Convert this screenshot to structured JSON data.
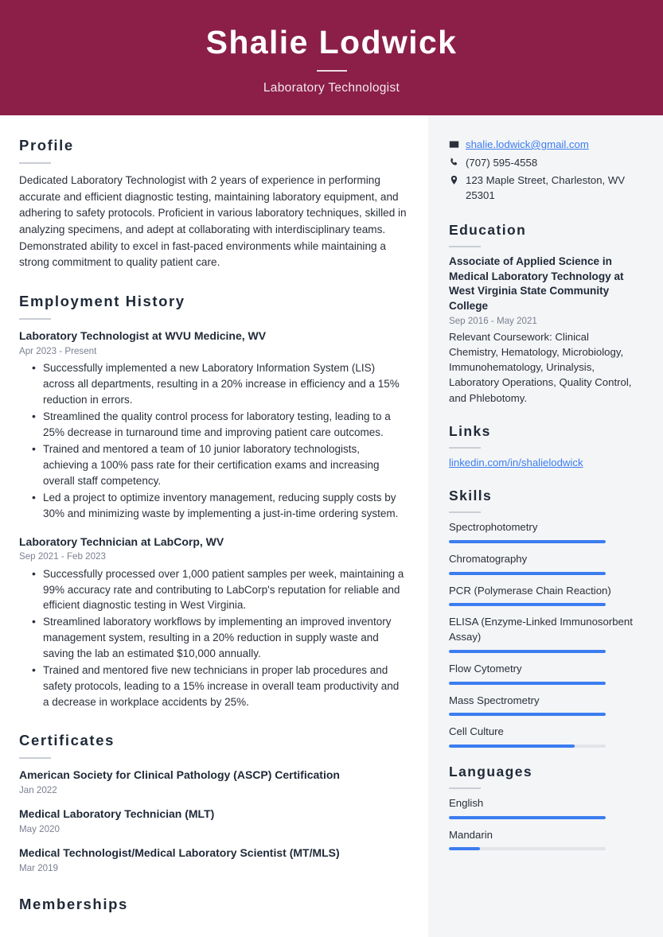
{
  "header": {
    "name": "Shalie Lodwick",
    "job_title": "Laboratory Technologist",
    "bg_color": "#8B1F47"
  },
  "accent": {
    "bar_color": "#3B7DF0",
    "link_color": "#3B7DF0",
    "sidebar_bg": "#F4F5F7"
  },
  "main": {
    "profile": {
      "heading": "Profile",
      "text": "Dedicated Laboratory Technologist with 2 years of experience in performing accurate and efficient diagnostic testing, maintaining laboratory equipment, and adhering to safety protocols. Proficient in various laboratory techniques, skilled in analyzing specimens, and adept at collaborating with interdisciplinary teams. Demonstrated ability to excel in fast-paced environments while maintaining a strong commitment to quality patient care."
    },
    "employment": {
      "heading": "Employment History",
      "jobs": [
        {
          "title": "Laboratory Technologist at WVU Medicine, WV",
          "date": "Apr 2023 - Present",
          "bullets": [
            "Successfully implemented a new Laboratory Information System (LIS) across all departments, resulting in a 20% increase in efficiency and a 15% reduction in errors.",
            "Streamlined the quality control process for laboratory testing, leading to a 25% decrease in turnaround time and improving patient care outcomes.",
            "Trained and mentored a team of 10 junior laboratory technologists, achieving a 100% pass rate for their certification exams and increasing overall staff competency.",
            "Led a project to optimize inventory management, reducing supply costs by 30% and minimizing waste by implementing a just-in-time ordering system."
          ]
        },
        {
          "title": "Laboratory Technician at LabCorp, WV",
          "date": "Sep 2021 - Feb 2023",
          "bullets": [
            "Successfully processed over 1,000 patient samples per week, maintaining a 99% accuracy rate and contributing to LabCorp's reputation for reliable and efficient diagnostic testing in West Virginia.",
            "Streamlined laboratory workflows by implementing an improved inventory management system, resulting in a 20% reduction in supply waste and saving the lab an estimated $10,000 annually.",
            "Trained and mentored five new technicians in proper lab procedures and safety protocols, leading to a 15% increase in overall team productivity and a decrease in workplace accidents by 25%."
          ]
        }
      ]
    },
    "certificates": {
      "heading": "Certificates",
      "items": [
        {
          "title": "American Society for Clinical Pathology (ASCP) Certification",
          "date": "Jan 2022"
        },
        {
          "title": "Medical Laboratory Technician (MLT)",
          "date": "May 2020"
        },
        {
          "title": "Medical Technologist/Medical Laboratory Scientist (MT/MLS)",
          "date": "Mar 2019"
        }
      ]
    },
    "memberships": {
      "heading": "Memberships"
    }
  },
  "sidebar": {
    "contact": [
      {
        "icon": "envelope-icon",
        "text": "shalie.lodwick@gmail.com",
        "is_link": true
      },
      {
        "icon": "phone-icon",
        "text": "(707) 595-4558",
        "is_link": false
      },
      {
        "icon": "location-pin-icon",
        "text": "123 Maple Street, Charleston, WV 25301",
        "is_link": false
      }
    ],
    "education": {
      "heading": "Education",
      "title": "Associate of Applied Science in Medical Laboratory Technology at West Virginia State Community College",
      "date": "Sep 2016 - May 2021",
      "description": "Relevant Coursework: Clinical Chemistry, Hematology, Microbiology, Immunohematology, Urinalysis, Laboratory Operations, Quality Control, and Phlebotomy."
    },
    "links": {
      "heading": "Links",
      "items": [
        {
          "label": "linkedin.com/in/shalielodwick"
        }
      ]
    },
    "skills": {
      "heading": "Skills",
      "items": [
        {
          "label": "Spectrophotometry",
          "level": 100
        },
        {
          "label": "Chromatography",
          "level": 100
        },
        {
          "label": "PCR (Polymerase Chain Reaction)",
          "level": 100
        },
        {
          "label": "ELISA (Enzyme-Linked Immunosorbent Assay)",
          "level": 100
        },
        {
          "label": "Flow Cytometry",
          "level": 100
        },
        {
          "label": "Mass Spectrometry",
          "level": 100
        },
        {
          "label": "Cell Culture",
          "level": 80
        }
      ]
    },
    "languages": {
      "heading": "Languages",
      "items": [
        {
          "label": "English",
          "level": 100
        },
        {
          "label": "Mandarin",
          "level": 20
        }
      ]
    }
  }
}
